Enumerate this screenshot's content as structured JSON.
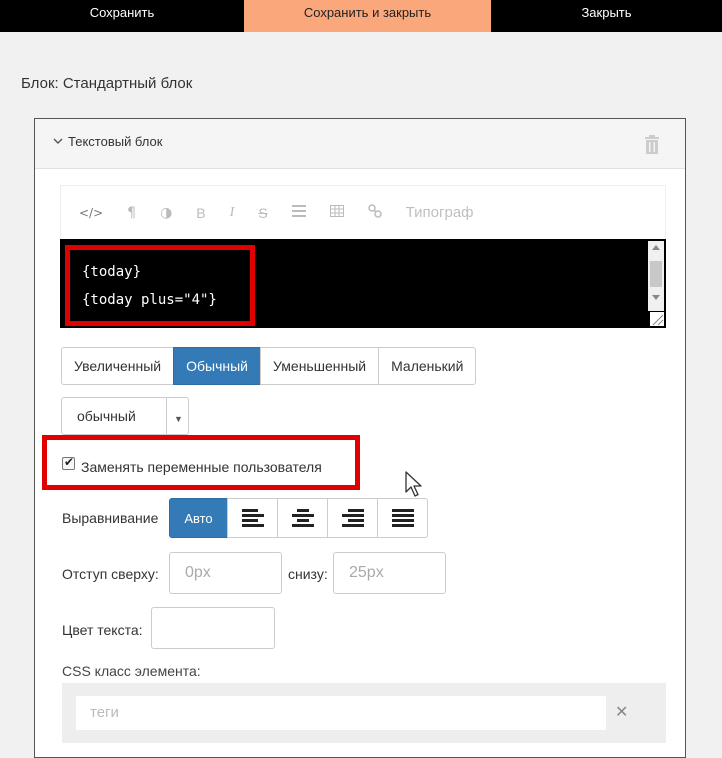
{
  "toolbar": {
    "save": "Сохранить",
    "save_close": "Сохранить и закрыть",
    "close": "Закрыть"
  },
  "block_title": "Блок: Стандартный блок",
  "panel": {
    "title": "Текстовый блок"
  },
  "editor": {
    "buttons": [
      "</>",
      "¶",
      "◑",
      "B",
      "I",
      "S",
      "list",
      "table",
      "link"
    ],
    "typograph": "Типограф",
    "code_lines": [
      "{today}",
      "{today plus=\"4\"}"
    ]
  },
  "size_buttons": [
    "Увеличенный",
    "Обычный",
    "Уменьшенный",
    "Маленький"
  ],
  "size_active": "Обычный",
  "style_select": {
    "value": "обычный"
  },
  "replace_vars": {
    "label": "Заменять переменные пользователя",
    "checked": true
  },
  "alignment": {
    "label": "Выравнивание",
    "auto": "Авто",
    "options": [
      "align-left-icon",
      "align-center-icon",
      "align-right-icon",
      "align-justify-icon"
    ]
  },
  "margins": {
    "top_label": "Отступ сверху:",
    "top_placeholder": "0px",
    "bottom_label": "снизу:",
    "bottom_placeholder": "25px"
  },
  "text_color": {
    "label": "Цвет текста:",
    "value": ""
  },
  "css_class": {
    "label": "CSS класс элемента:",
    "placeholder": "теги"
  },
  "colors": {
    "accent": "#337ab7",
    "save_close_bg": "#f9a77b",
    "highlight": "#e00000"
  }
}
